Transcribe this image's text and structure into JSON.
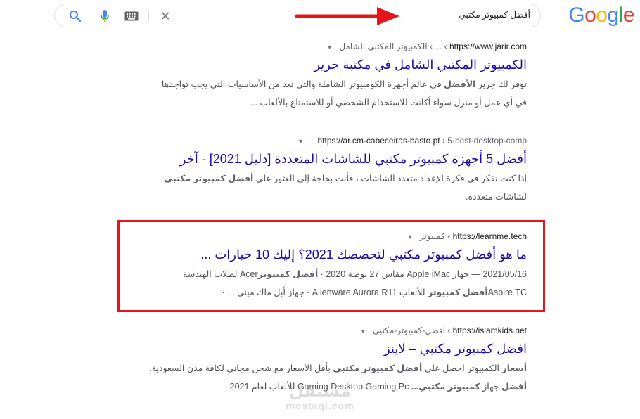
{
  "header": {
    "logo": [
      "G",
      "o",
      "o",
      "g",
      "l",
      "e"
    ],
    "logo_colors": [
      "#4285f4",
      "#ea4335",
      "#fbbc05",
      "#4285f4",
      "#34a853",
      "#ea4335"
    ],
    "query": "أفضل كمبيوتر مكتبي",
    "close_symbol": "✕"
  },
  "annotation": {
    "arrow_color": "#e8141b",
    "highlight_color": "#e8141b"
  },
  "results": [
    {
      "url": "https://www.jarir.com",
      "path": "› ... › الكمبيوتر المكتبي الشامل",
      "title": "الكمبيوتر المكتبي الشامل في مكتبة جرير",
      "snippet_line1_a": "توفر لك جرير ",
      "snippet_line1_b": "الأفضل",
      "snippet_line1_c": " في عالم أجهزة الكومبيوتر الشاملة والتي تعد من الأساسيات التي يجب تواجدها",
      "snippet_line2": "في أي عمل أو منزل سواء أكانت للاستخدام الشخصي أو للاستمتاع بالألعاب ..."
    },
    {
      "url": "https://ar.cm-cabeceiras-basto.pt",
      "path": "› 5-best-desktop-comp...",
      "title": "أفضل 5 أجهزة كمبيوتر مكتبي للشاشات المتعددة [دليل 2021] - آخر",
      "snippet_line1_a": "إذا كنت تفكر في فكرة الإعداد متعدد الشاشات ، فأنت بحاجة إلى العثور على ",
      "snippet_line1_b": "أفضل كمبيوتر مكتبي",
      "snippet_line2": "لشاشات متعددة."
    },
    {
      "url": "https://learnme.tech",
      "path": "› كمبيوتر",
      "title": "ما هو أفضل كمبيوتر مكتبي لتخصصك 2021؟ إليك 10 خيارات ...",
      "snippet_line1_date": "2021/05/16",
      "snippet_line1_a": " — جهاز Apple iMac مقاس 27 بوصة 2020 · ",
      "snippet_line1_b": "أفضل كمبيوتر",
      "snippet_line1_c": "Acer لطلاب الهندسة",
      "snippet_line2_a": "Aspire TC",
      "snippet_line2_b": "أفضل كمبيوتر",
      "snippet_line2_c": " للألعاب Alienware Aurora R11 · جهاز أبل ماك ميني ... ·"
    },
    {
      "url": "https://islamkids.net",
      "path": "› افضل-كمبيوتر-مكتبي",
      "title": "افضل كمبيوتر مكتبي – لاينز",
      "snippet_line1_a": "أسعار",
      "snippet_line1_b": " الكمبيوتر احصل على ",
      "snippet_line1_c": "أفضل كمبيوتر مكتبي",
      "snippet_line1_d": " بأقل الأسعار مع شحن مجاني لكافة مدن السعودية.",
      "snippet_line2_a": "أفضل",
      "snippet_line2_b": " جهاز ",
      "snippet_line2_c": "كمبيوتر مكتبي...",
      "snippet_line2_d": " Gaming Desktop Gaming Pc للألعاب لعام 2021"
    }
  ],
  "watermark": {
    "arabic": "مستقل",
    "latin": "mostaql.com"
  }
}
